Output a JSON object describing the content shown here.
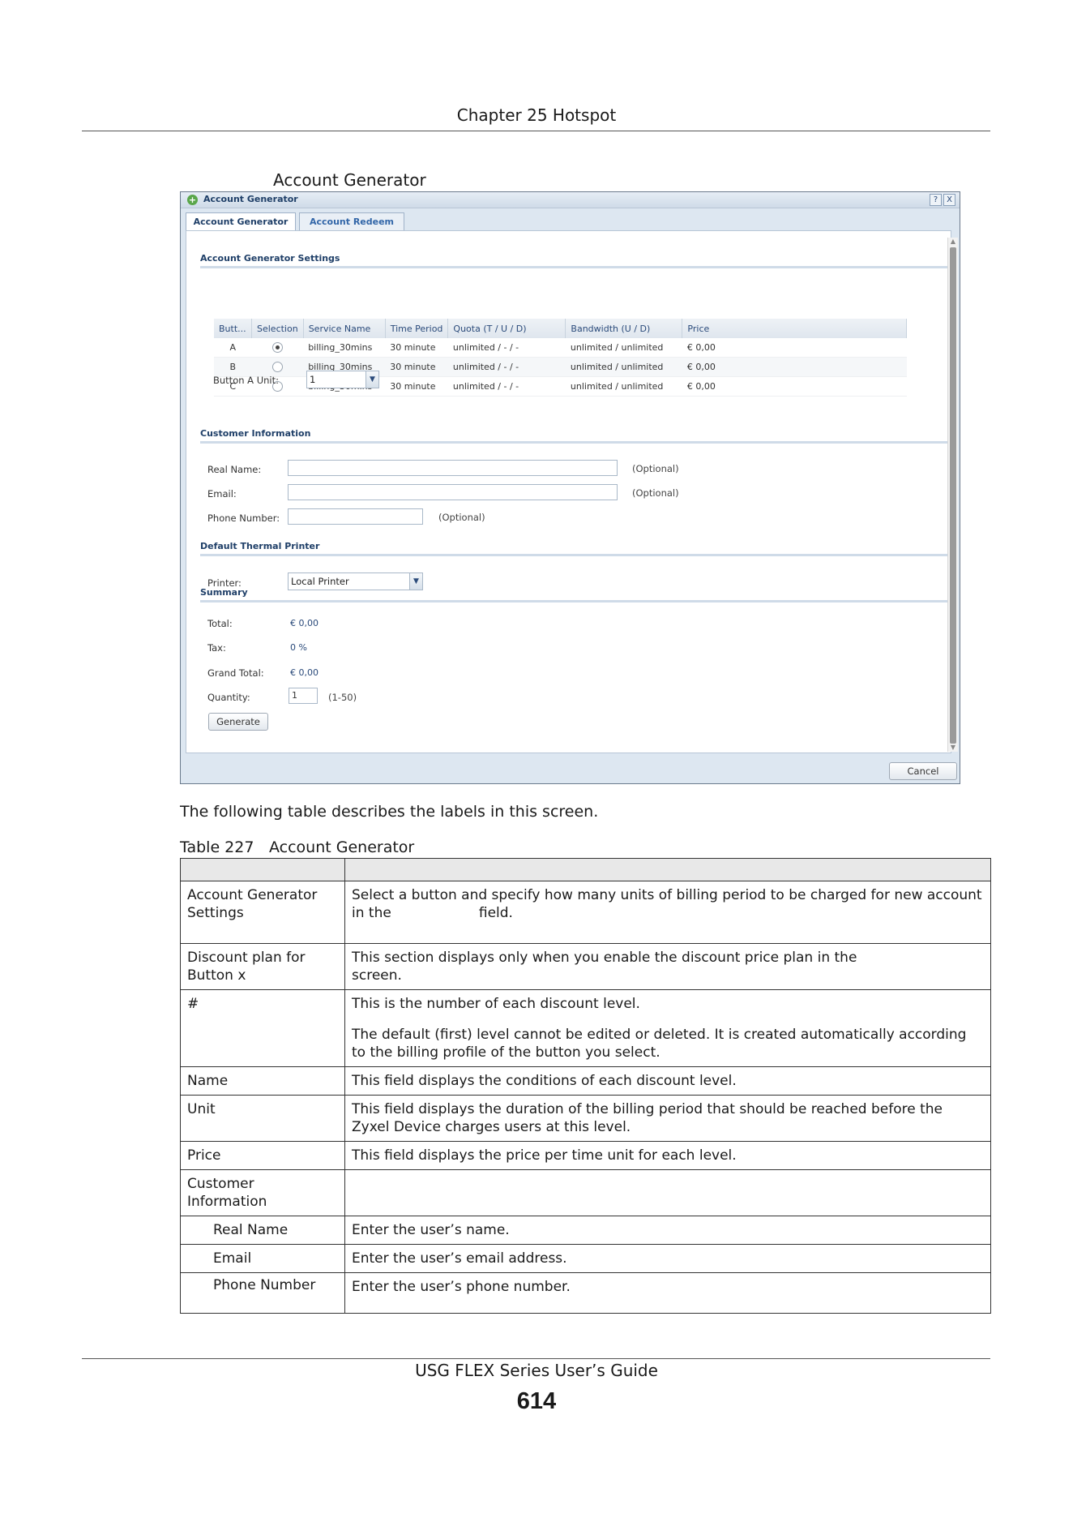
{
  "header": {
    "chapter": "Chapter 25 Hotspot"
  },
  "figure": {
    "title": "Account Generator"
  },
  "window": {
    "title": "Account Generator",
    "help_icon": "?",
    "close_icon": "X",
    "tabs": [
      "Account Generator",
      "Account Redeem"
    ],
    "sections": {
      "settings": "Account Generator Settings",
      "customer": "Customer Information",
      "printer": "Default Thermal Printer",
      "summary": "Summary"
    },
    "table": {
      "columns": [
        "Butt...",
        "Selection",
        "Service Name",
        "Time Period",
        "Quota (T / U / D)",
        "Bandwidth (U / D)",
        "Price"
      ],
      "rows": [
        {
          "button": "A",
          "selected": true,
          "service": "billing_30mins",
          "period": "30 minute",
          "quota": "unlimited / - / -",
          "bandwidth": "unlimited / unlimited",
          "price": "€ 0,00"
        },
        {
          "button": "B",
          "selected": false,
          "service": "billing_30mins",
          "period": "30 minute",
          "quota": "unlimited / - / -",
          "bandwidth": "unlimited / unlimited",
          "price": "€ 0,00"
        },
        {
          "button": "C",
          "selected": false,
          "service": "billing_30mins",
          "period": "30 minute",
          "quota": "unlimited / - / -",
          "bandwidth": "unlimited / unlimited",
          "price": "€ 0,00"
        }
      ]
    },
    "button_unit": {
      "label": "Button A Unit:",
      "value": "1"
    },
    "customer": {
      "real_name_label": "Real Name:",
      "email_label": "Email:",
      "phone_label": "Phone Number:",
      "optional": "(Optional)"
    },
    "printer": {
      "label": "Printer:",
      "value": "Local Printer"
    },
    "summary": {
      "total_label": "Total:",
      "total": "€ 0,00",
      "tax_label": "Tax:",
      "tax": "0 %",
      "grand_label": "Grand Total:",
      "grand": "€ 0,00",
      "quantity_label": "Quantity:",
      "quantity": "1",
      "quantity_range": "(1-50)"
    },
    "generate_label": "Generate",
    "cancel_label": "Cancel"
  },
  "doc": {
    "intro": "The following table describes the labels in this screen.",
    "table_caption_num": "Table 227",
    "table_caption": "Account Generator",
    "rows": [
      {
        "label": "Account Generator Settings",
        "desc": "Select a button and specify how many units of billing period to be charged for new account in the                    field."
      },
      {
        "label": "Discount plan for Button x",
        "desc": "This section displays only when you enable the discount price plan in the\nscreen."
      },
      {
        "label": "#",
        "desc": "This is the number of each discount level.",
        "desc2": "The default (first) level cannot be edited or deleted. It is created automatically according to the billing profile of the button you select."
      },
      {
        "label": "Name",
        "desc": "This field displays the conditions of each discount level."
      },
      {
        "label": "Unit",
        "desc": "This field displays the duration of the billing period that should be reached before the Zyxel Device charges users at this level."
      },
      {
        "label": "Price",
        "desc": "This field displays the price per time unit for each level."
      },
      {
        "label": "Customer Information",
        "desc": ""
      },
      {
        "label": "Real Name",
        "desc": "Enter the user’s name."
      },
      {
        "label": "Email",
        "desc": "Enter the user’s email address."
      },
      {
        "label": "Phone Number",
        "desc": "Enter the user’s phone number."
      }
    ]
  },
  "footer": {
    "guide": "USG FLEX Series User’s Guide",
    "page": "614"
  }
}
